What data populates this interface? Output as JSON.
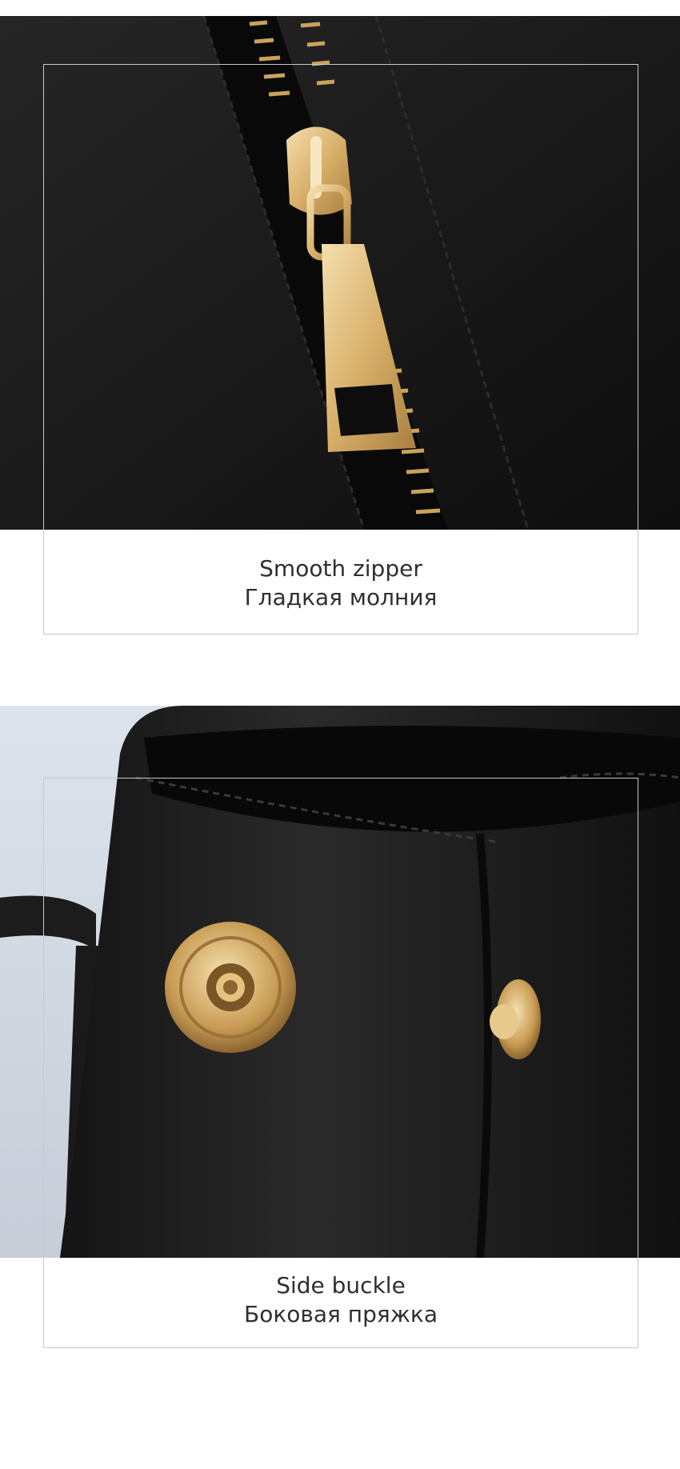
{
  "features": [
    {
      "caption_en": "Smooth zipper",
      "caption_ru": "Гладкая молния",
      "photo": "zipper-closeup"
    },
    {
      "caption_en": "Side buckle",
      "caption_ru": "Боковая пряжка",
      "photo": "snap-button-closeup"
    }
  ],
  "colors": {
    "leather": "#161616",
    "gold": "#d9b36a",
    "caption": "#2f2f2f",
    "frame": "#c9c9c9"
  }
}
